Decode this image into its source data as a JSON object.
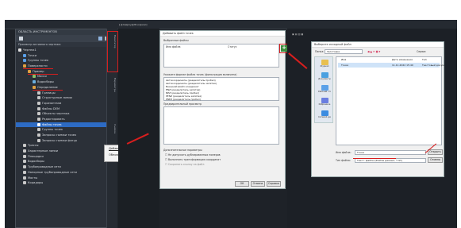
{
  "toolspace": {
    "title": "ОБЛАСТЬ ИНСТРУМЕНТОВ",
    "subtitle": "Просмотр активного чертежа",
    "tree": [
      {
        "label": "Чертеж1",
        "depth": 0,
        "color": "#e0e0e0"
      },
      {
        "label": "Точки",
        "depth": 1,
        "color": "#5aa0e8"
      },
      {
        "label": "Группы точек",
        "depth": 1,
        "color": "#5aa0e8"
      },
      {
        "label": "Поверхности",
        "depth": 1,
        "color": "#e0a040",
        "underline": true
      },
      {
        "label": "Пример",
        "depth": 2,
        "color": "#e0a040",
        "underline": true
      },
      {
        "label": "Маски",
        "depth": 3,
        "color": "#8ac06a"
      },
      {
        "label": "Водосборы",
        "depth": 3,
        "color": "#6ab0e0"
      },
      {
        "label": "Определение",
        "depth": 3,
        "color": "#e0a040",
        "underline": true
      },
      {
        "label": "Границы",
        "depth": 4,
        "color": "#c8c8c8"
      },
      {
        "label": "Структурные линии",
        "depth": 4,
        "color": "#c8c8c8"
      },
      {
        "label": "Горизонтали",
        "depth": 4,
        "color": "#c8c8c8"
      },
      {
        "label": "Файлы DEM",
        "depth": 4,
        "color": "#c8c8c8"
      },
      {
        "label": "Объекты чертежа",
        "depth": 4,
        "color": "#c8c8c8"
      },
      {
        "label": "Редактировать",
        "depth": 4,
        "color": "#c8c8c8"
      },
      {
        "label": "Файлы точек",
        "depth": 4,
        "color": "#ffffff",
        "selected": true
      },
      {
        "label": "Группы точек",
        "depth": 4,
        "color": "#c8c8c8"
      },
      {
        "label": "Запросы съемки точек",
        "depth": 4,
        "color": "#c8c8c8"
      },
      {
        "label": "Запросы съемки фигур",
        "depth": 4,
        "color": "#c8c8c8"
      },
      {
        "label": "Трассы",
        "depth": 1,
        "color": "#c8c8c8"
      },
      {
        "label": "Характерные линии",
        "depth": 1,
        "color": "#c8c8c8"
      },
      {
        "label": "Площадки",
        "depth": 1,
        "color": "#c8c8c8"
      },
      {
        "label": "Водосборы",
        "depth": 1,
        "color": "#c8c8c8"
      },
      {
        "label": "Трубопроводные сети",
        "depth": 1,
        "color": "#c8c8c8"
      },
      {
        "label": "Напорные трубопроводные сети",
        "depth": 1,
        "color": "#c8c8c8"
      },
      {
        "label": "Мосты",
        "depth": 1,
        "color": "#c8c8c8"
      },
      {
        "label": "Коридоры",
        "depth": 1,
        "color": "#c8c8c8"
      }
    ],
    "vtabs": [
      "Навигатор",
      "Параметры",
      "Съемка"
    ]
  },
  "context_menu": {
    "items": [
      "Добавить...",
      "Обновить"
    ]
  },
  "add_dialog": {
    "title": "Добавить файл точек",
    "files_label": "Выбранные файлы",
    "col_name": "Имя файла",
    "col_status": "Статус",
    "format_label": "Укажите формат файла точек (фильтрация включена)",
    "formats": [
      "Автокоординаты (разделитель пробел)",
      "Автокоординаты (разделитель запятая)",
      "Внешний файл координат",
      "ENZ (разделитель запятая)",
      "NEZ (разделитель пробел)",
      "PENZ (разделитель запятая)",
      "PNEZ (разделитель пробел)"
    ],
    "preview_label": "Предварительный просмотр",
    "options_label": "Дополнительные параметры",
    "opt1": "Не допускать дублированных номеров",
    "opt2": "Выполнять трансформацию координат",
    "opt3": "Сохранять ссылку на файл",
    "ok": "ОК",
    "cancel": "Отмена",
    "help": "Справка"
  },
  "file_dialog": {
    "title": "Выберите исходный файл",
    "look_in_label": "Папка:",
    "folder": "Заготовки",
    "toolbar_label": "Сервис",
    "col_name": "Имя",
    "col_date": "Дата изменения",
    "col_type": "Тип",
    "file_name": "Точки",
    "file_date": "11.11.2022 15:40",
    "file_type": "Текстовый докум.",
    "filename_label": "Имя файла:",
    "filename_value": "Точки",
    "filetype_label": "Тип файла:",
    "filetype_value": "Текст. файлы (Файлы данных, *.txt)",
    "open": "Открыть",
    "cancel": "Отмена",
    "places": [
      "Журнал",
      "Документы",
      "Рабочий стол",
      "Избранное",
      "Сетевой диск"
    ]
  },
  "colors": {
    "accent_red": "#d81e1e",
    "selection": "#2d6bc4",
    "panel": "#2b3038"
  }
}
